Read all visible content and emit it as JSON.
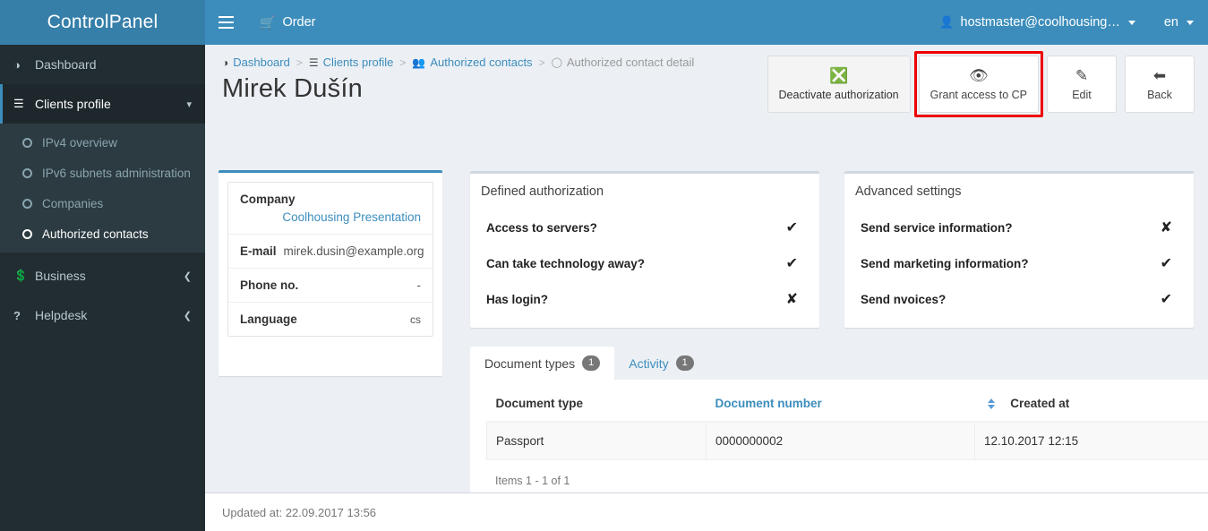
{
  "brand": {
    "title": "ControlPanel",
    "color": "#3c8dbc"
  },
  "navbar": {
    "burger_icon": "hamburger-icon",
    "order_label": "Order",
    "order_icon": "shopping-cart-icon",
    "user_label": "hostmaster@coolhousing…",
    "user_icon": "user-icon",
    "lang_label": "en"
  },
  "sidebar": {
    "items": [
      {
        "label": "Dashboard",
        "icon": "dashboard-icon",
        "state": "normal"
      },
      {
        "label": "Clients profile",
        "icon": "server-list-icon",
        "state": "active",
        "arrow": "chevron-down-icon"
      },
      {
        "label": "Business",
        "icon": "money-bill-icon",
        "state": "normal",
        "arrow": "chevron-left-icon"
      },
      {
        "label": "Helpdesk",
        "icon": "question-mark-icon",
        "state": "normal",
        "arrow": "chevron-left-icon"
      }
    ],
    "submenu": [
      {
        "label": "IPv4 overview",
        "selected": false
      },
      {
        "label": "IPv6 subnets administration",
        "selected": false
      },
      {
        "label": "Companies",
        "selected": false
      },
      {
        "label": "Authorized contacts",
        "selected": true
      }
    ]
  },
  "breadcrumb": [
    {
      "label": "Dashboard",
      "icon": "dashboard-icon",
      "link": true
    },
    {
      "label": "Clients profile",
      "icon": "server-list-icon",
      "link": true
    },
    {
      "label": "Authorized contacts",
      "icon": "users-group-icon",
      "link": true
    },
    {
      "label": "Authorized contact detail",
      "icon": "circle-icon",
      "link": false
    }
  ],
  "page_title": "Mirek Dušín",
  "actions": [
    {
      "label": "Deactivate authorization",
      "icon": "circle-x-icon",
      "style": "muted",
      "highlighted": false
    },
    {
      "label": "Grant access to CP",
      "icon": "eye-icon",
      "style": "default",
      "highlighted": true
    },
    {
      "label": "Edit",
      "icon": "pencil-square-icon",
      "style": "default",
      "highlighted": false
    },
    {
      "label": "Back",
      "icon": "arrow-left-icon",
      "style": "default",
      "highlighted": false
    }
  ],
  "highlight_color": "#ee0000",
  "info_card": {
    "company_label": "Company",
    "company_value": "Coolhousing Presentation",
    "email_label": "E-mail",
    "email_value": "mirek.dusin@example.org",
    "phone_label": "Phone no.",
    "phone_value": "-",
    "language_label": "Language",
    "language_value": "cs"
  },
  "defined_authorization": {
    "title": "Defined authorization",
    "rows": [
      {
        "question": "Access to servers?",
        "answer": "✔"
      },
      {
        "question": "Can take technology away?",
        "answer": "✔"
      },
      {
        "question": "Has login?",
        "answer": "✘"
      }
    ]
  },
  "advanced_settings": {
    "title": "Advanced settings",
    "rows": [
      {
        "question": "Send service information?",
        "answer": "✘"
      },
      {
        "question": "Send marketing information?",
        "answer": "✔"
      },
      {
        "question": "Send nvoices?",
        "answer": "✔"
      }
    ]
  },
  "tabs": [
    {
      "label": "Document types",
      "badge": "1",
      "active": true
    },
    {
      "label": "Activity",
      "badge": "1",
      "active": false
    }
  ],
  "table": {
    "columns": [
      {
        "label": "Document type",
        "link": false,
        "sortable": false
      },
      {
        "label": "Document number",
        "link": true,
        "sortable": true
      },
      {
        "label": "Created at",
        "link": false,
        "sortable": false
      }
    ],
    "rows": [
      {
        "document_type": "Passport",
        "document_number": "0000000002",
        "created_at": "12.10.2017 12:15"
      }
    ],
    "items_note": "Items 1 - 1 of 1"
  },
  "footer": {
    "updated_at": "Updated at: 22.09.2017 13:56"
  }
}
